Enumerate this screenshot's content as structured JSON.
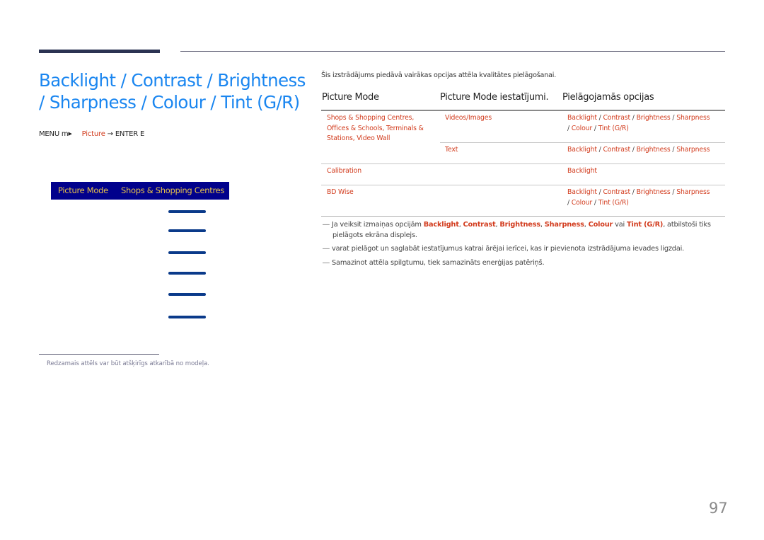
{
  "header": {
    "title_line1": "Backlight / Contrast / Brightness",
    "title_line2": "/ Sharpness / Colour / Tint (G/R)"
  },
  "menu_path": {
    "menu": "MENU m",
    "arrow1": "→",
    "picture": "Picture",
    "arrow2": "→",
    "enter": "ENTER E"
  },
  "osd": {
    "label": "Picture Mode",
    "value": "Shops & Shopping Centres",
    "slider_count": 6
  },
  "footnote": "Redzamais attēls var būt atšķirīgs atkarībā no modeļa.",
  "intro": "Šis izstrādājums piedāvā vairākas opcijas attēla kvalitātes pielāgošanai.",
  "table": {
    "headers": [
      "Picture Mode",
      "Picture Mode iestatījumi.",
      "Pielāgojamās opcijas"
    ],
    "rows": [
      {
        "mode_line1": "Shops & Shopping Centres,",
        "mode_line2": "Offices & Schools,  Terminals &",
        "mode_line3": "Stations, Video Wall",
        "setting": "Videos/Images",
        "options": [
          "Backlight",
          "Contrast",
          "Brightness",
          "Sharpness",
          "Colour",
          "Tint (G/R)"
        ]
      },
      {
        "mode": "",
        "setting": "Text",
        "options": [
          "Backlight",
          "Contrast",
          "Brightness",
          "Sharpness"
        ]
      },
      {
        "mode": "Calibration",
        "setting": "",
        "options": [
          "Backlight"
        ]
      },
      {
        "mode": "BD Wise",
        "setting": "",
        "options": [
          "Backlight",
          "Contrast",
          "Brightness",
          "Sharpness",
          "Colour",
          "Tint (G/R)"
        ]
      }
    ],
    "separator": "/"
  },
  "notes": {
    "dash": "―",
    "n1_prefix": "Ja veiksit izmaiņas opcijām ",
    "n1_opts": [
      "Backlight",
      "Contrast",
      "Brightness",
      "Sharpness",
      "Colour",
      "Tint (G/R)"
    ],
    "comma": ", ",
    "n1_or": " vai ",
    "n1_suffix": ", atbilstoši tiks",
    "n1_line2": "pielāgots ekrāna displejs.",
    "n2": "varat pielāgot un saglabāt iestatījumus katrai ārējai ierīcei, kas ir pievienota izstrādājuma ievades ligzdai.",
    "n3": "Samazinot attēla spilgtumu, tiek samazināts enerģijas patēriņš."
  },
  "page_number": "97"
}
